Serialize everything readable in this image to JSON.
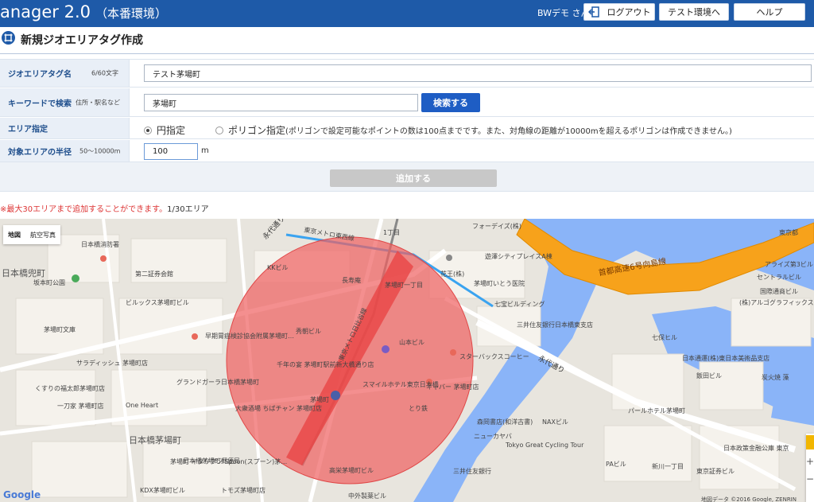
{
  "header": {
    "app_title": "anager 2.0",
    "environment": "（本番環境）",
    "user": "BWデモ さん",
    "buttons": {
      "logout": "ログアウト",
      "test_env": "テスト環境へ",
      "help": "ヘルプ"
    }
  },
  "page": {
    "title": "新規ジオエリアタグ作成"
  },
  "form": {
    "name": {
      "label": "ジオエリアタグ名",
      "hint": "6/60文字",
      "value": "テスト茅場町"
    },
    "keyword": {
      "label": "キーワードで検索",
      "hint": "住所・駅名など",
      "value": "茅場町",
      "search_button": "検索する"
    },
    "area": {
      "label": "エリア指定",
      "options": [
        {
          "label": "円指定",
          "selected": true
        },
        {
          "label": "ポリゴン指定",
          "selected": false
        }
      ],
      "polygon_note": "(ポリゴンで設定可能なポイントの数は100点までです。また、対角線の距離が10000mを超えるポリゴンは作成できません。)"
    },
    "radius": {
      "label": "対象エリアの半径",
      "hint": "50〜10000m",
      "value": "100",
      "unit": "m"
    },
    "add_button": "追加する"
  },
  "limit_note": {
    "warning": "※最大30エリアまで追加することができます。",
    "count": "1/30エリア"
  },
  "map": {
    "type_buttons": [
      "地図",
      "航空写真"
    ],
    "labels": [
      "永代通り",
      "東京メトロ東西線",
      "東京メトロ日比谷線",
      "首都高速6号向島線",
      "永代通り",
      "日本橋兜町",
      "日本橋茅場町",
      "茅場町",
      "茅場町一丁目",
      "新川一丁目",
      "スターバックスコーヒー",
      "スマイルホテル東京日本橋",
      "高栄茅場町ビル",
      "日本橋消防署",
      "坂本町公園",
      "茅場町文庫",
      "サラディッシュ 茅場町店",
      "くすりの福太郎茅場町店",
      "One Heart",
      "日本橋茅場町郵便局",
      "七宝ビルディング",
      "三井住友銀行日本橋東支店",
      "日本通運(株)東日本美術品支店",
      "パールホテル茅場町",
      "森岡書店(和洋古書)",
      "ニューカヤバ",
      "Tokyo Great Cycling Tour",
      "NAXビル",
      "PAビル",
      "日本政策金融公庫 東京",
      "東京証券ビル",
      "遊澤シティプレイスA棟",
      "フォーデイズ(株)",
      "花王(株)",
      "茅場町いとう医院",
      "山本ビル",
      "七保ヒル",
      "飯田ビル",
      "炭火焼 藻",
      "アライズ第3ビル",
      "セントラルビル",
      "国際通商ビル",
      "(株)アルゴグラフィックス",
      "早期胃癌検診協会附属茅場町…",
      "グランドガーラ日本橋茅場町",
      "大衆酒場 ちばチャン 茅場町店",
      "千年の宴 茅場町駅前新大橋通り店",
      "秀朝ビル",
      "長寿庵",
      "KKビル",
      "第二証券会館",
      "ビルックス茅場町ビル",
      "一刀家 茅場町店",
      "茅場町 イタリアン Spoon(スプーン)茅…",
      "トモズ茅場町店",
      "KDX茅場町ビル",
      "中外製薬ビル",
      "東京都",
      "1丁目",
      "ギャバー 茅場町店",
      "とり鉄",
      "三井住友銀行"
    ],
    "google": "Google",
    "credit": "地図データ ©2016 Google, ZENRIN"
  },
  "colors": {
    "header_bg": "#1e5aa8",
    "label_bg": "#e9eff7",
    "search_button": "#1e5dc4",
    "circle_fill": "#f06060",
    "highway": "#f7a21b",
    "water": "#8ab4f8"
  }
}
